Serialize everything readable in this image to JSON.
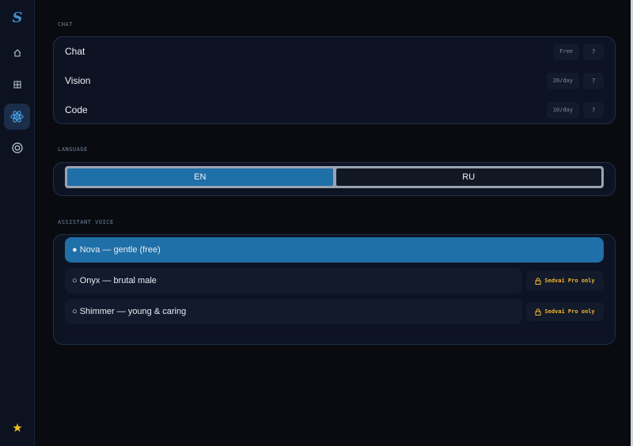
{
  "sidebar": {
    "logo": "S",
    "items": [
      {
        "name": "home-icon",
        "active": false
      },
      {
        "name": "grid-icon",
        "active": false
      },
      {
        "name": "atom-icon",
        "active": true
      },
      {
        "name": "target-icon",
        "active": false
      }
    ],
    "bottom_icon": "star-icon"
  },
  "chat_section": {
    "title": "CHAT",
    "rows": [
      {
        "label": "Chat",
        "limit": "Free",
        "help": "?"
      },
      {
        "label": "Vision",
        "limit": "20/day",
        "help": "?"
      },
      {
        "label": "Code",
        "limit": "10/day",
        "help": "?"
      }
    ]
  },
  "language_section": {
    "title": "LANGUAGE",
    "options": [
      "EN",
      "RU"
    ],
    "selected": "EN"
  },
  "voice_section": {
    "title": "ASSISTANT VOICE",
    "voices": [
      {
        "label": "● Nova — gentle (free)",
        "selected": true,
        "locked": false
      },
      {
        "label": "○ Onyx — brutal male",
        "selected": false,
        "locked": true,
        "badge": "Sedvai Pro only"
      },
      {
        "label": "○ Shimmer — young & caring",
        "selected": false,
        "locked": true,
        "badge": "Sedvai Pro only"
      }
    ]
  },
  "colors": {
    "accent": "#1f6fa8",
    "background": "#090b11",
    "pro_badge": "#f1b52a",
    "star": "#f3c21b"
  }
}
